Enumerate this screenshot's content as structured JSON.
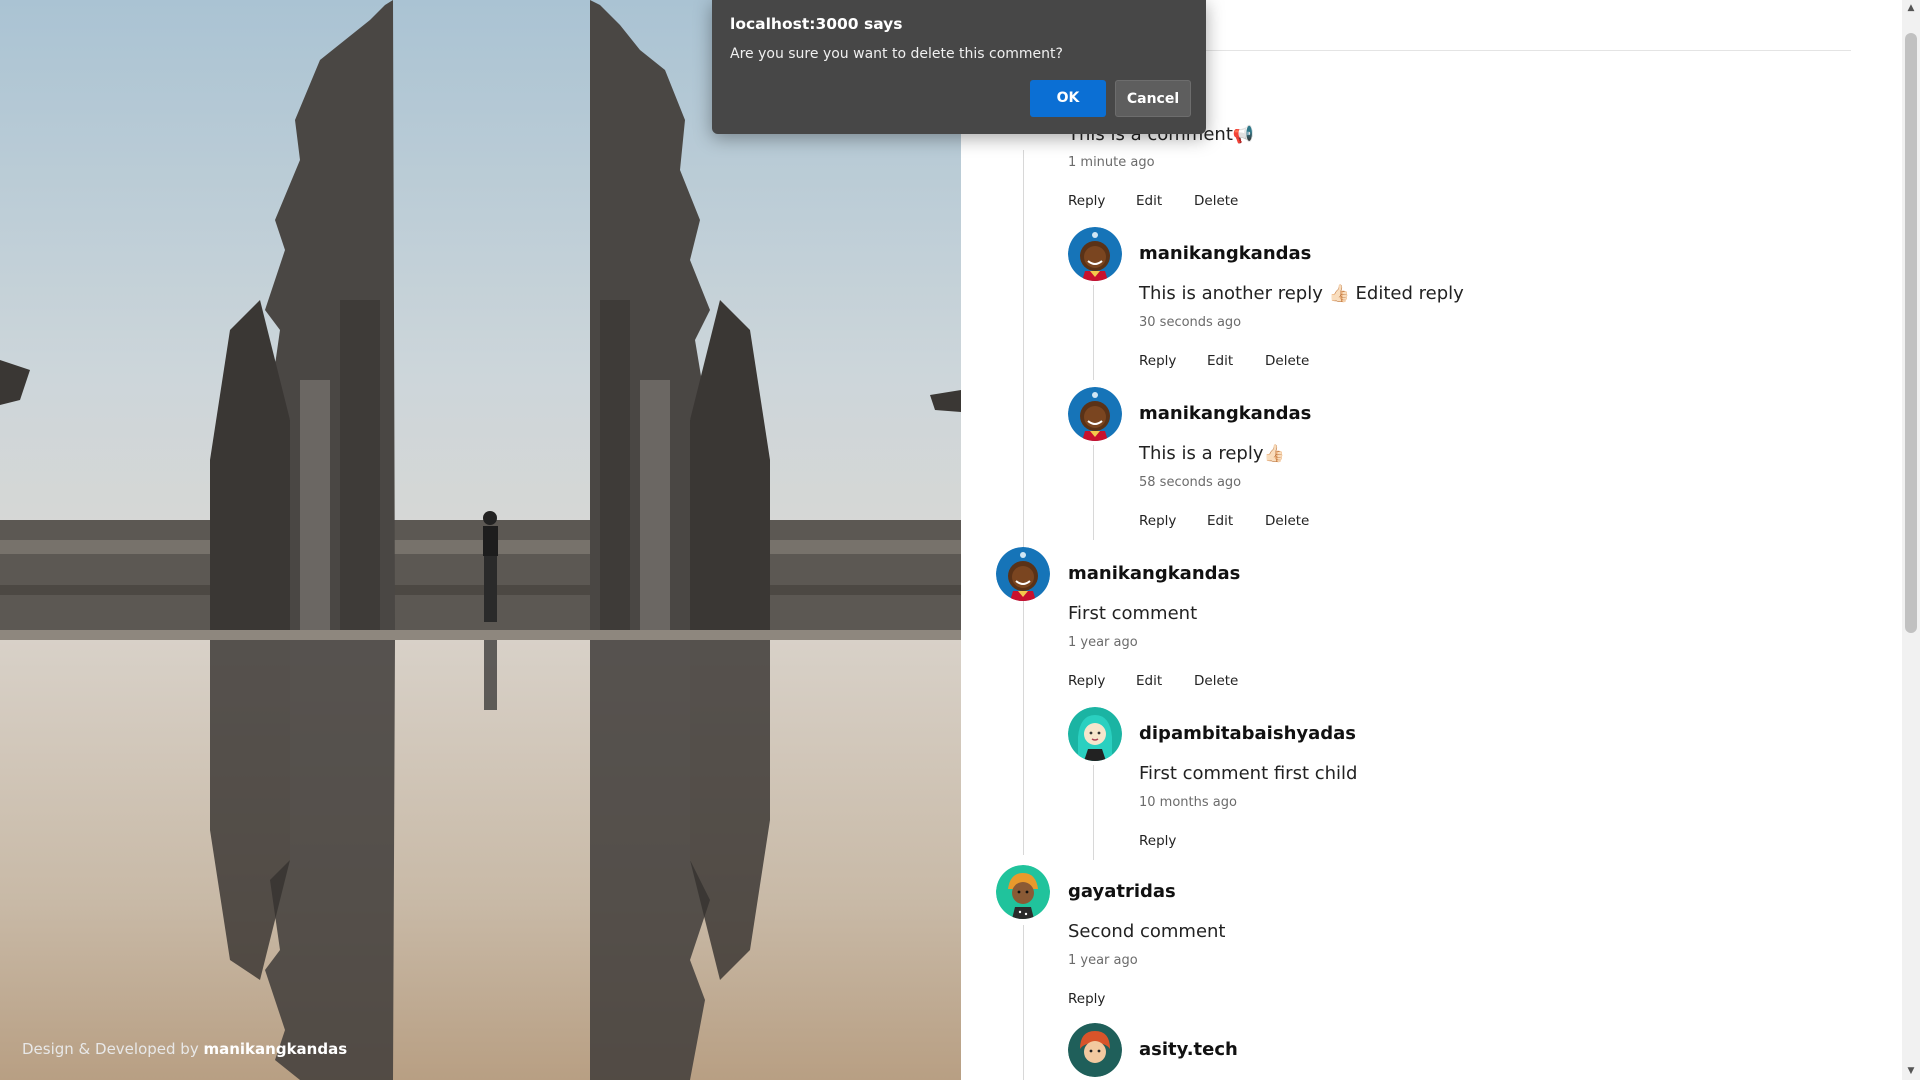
{
  "hero": {
    "credit_prefix": "Design & Developed by",
    "credit_name": "manikangkandas"
  },
  "dialog": {
    "title": "localhost:3000 says",
    "message": "Are you sure you want to delete this comment?",
    "ok_label": "OK",
    "cancel_label": "Cancel"
  },
  "actions": {
    "reply": "Reply",
    "edit": "Edit",
    "delete": "Delete"
  },
  "comments": [
    {
      "body": "This is a comment",
      "emoji": "📢",
      "time": "1 minute ago"
    },
    {
      "author": "manikangkandas",
      "body": "This is another reply",
      "emoji": "👍🏻",
      "body_suffix": "Edited reply",
      "time": "30 seconds ago"
    },
    {
      "author": "manikangkandas",
      "body": "This is a reply",
      "emoji": "👍🏻",
      "time": "58 seconds ago"
    },
    {
      "author": "manikangkandas",
      "body": "First comment",
      "time": "1 year ago"
    },
    {
      "author": "dipambitabaishyadas",
      "body": "First comment first child",
      "time": "10 months ago"
    },
    {
      "author": "gayatridas",
      "body": "Second comment",
      "time": "1 year ago"
    },
    {
      "author": "asity.tech"
    }
  ],
  "colors": {
    "ok_button": "#0b6fd4",
    "dialog_bg": "#474747",
    "avatar_blue": "#1674b8",
    "avatar_teal": "#1bb4a3",
    "avatar_green": "#20c39c"
  }
}
